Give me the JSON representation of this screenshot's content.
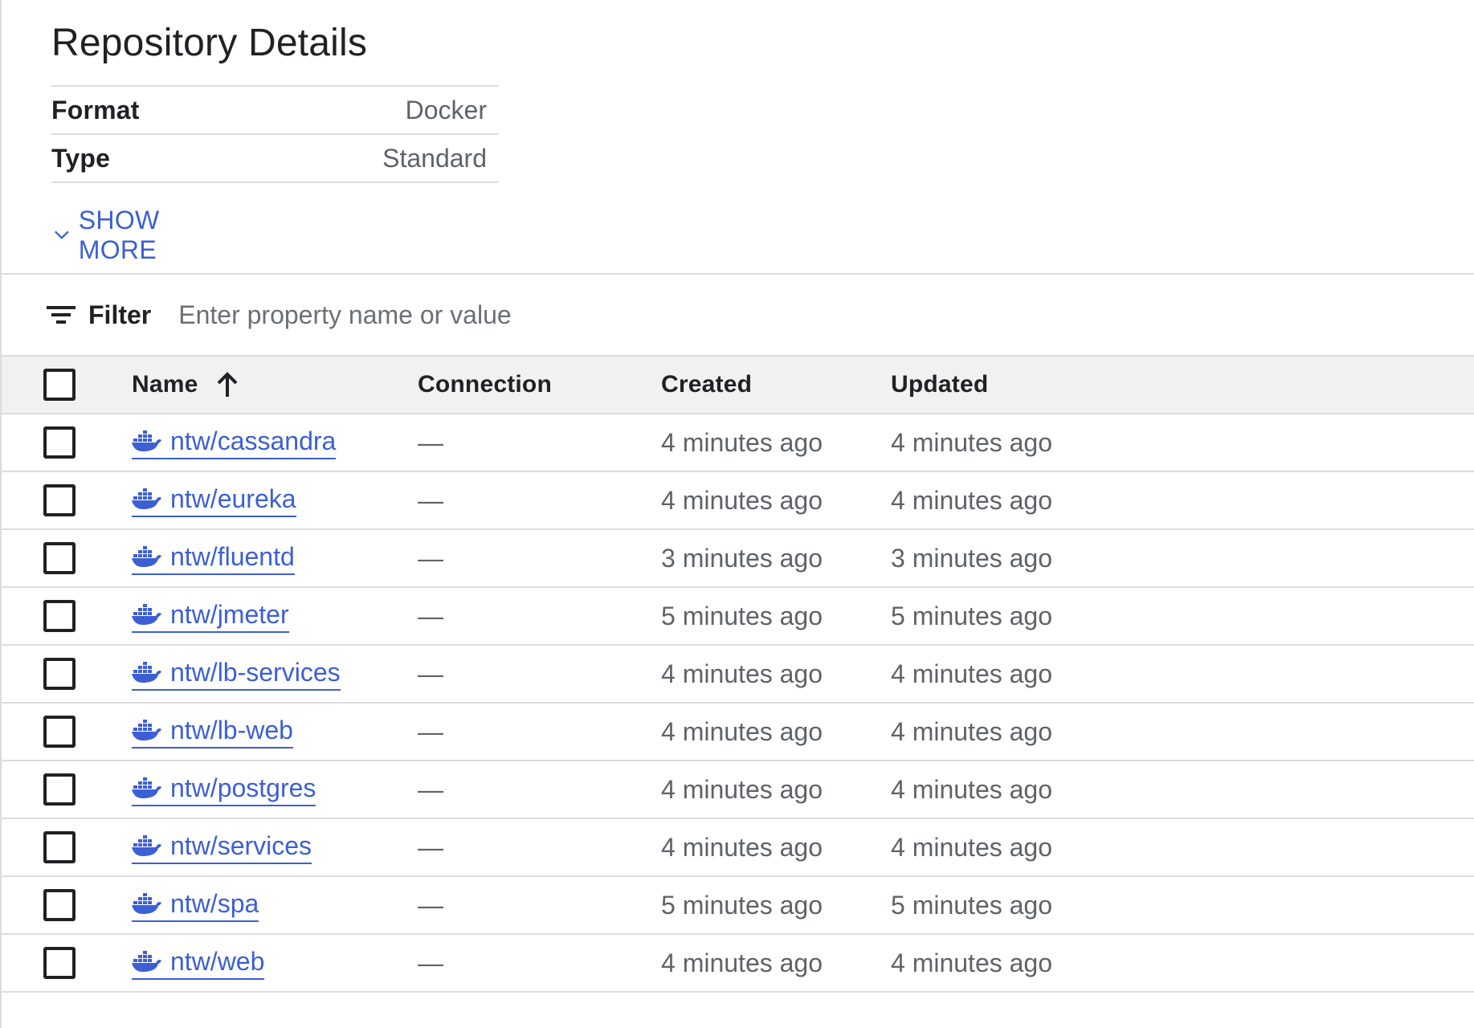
{
  "details": {
    "title": "Repository Details",
    "properties": [
      {
        "key": "Format",
        "value": "Docker"
      },
      {
        "key": "Type",
        "value": "Standard"
      }
    ],
    "show_more_label": "SHOW MORE"
  },
  "filter": {
    "label": "Filter",
    "placeholder": "Enter property name or value"
  },
  "table": {
    "columns": {
      "name": "Name",
      "connection": "Connection",
      "created": "Created",
      "updated": "Updated"
    },
    "sort": "name-ascending",
    "rows": [
      {
        "name": "ntw/cassandra",
        "connection": "—",
        "created": "4 minutes ago",
        "updated": "4 minutes ago"
      },
      {
        "name": "ntw/eureka",
        "connection": "—",
        "created": "4 minutes ago",
        "updated": "4 minutes ago"
      },
      {
        "name": "ntw/fluentd",
        "connection": "—",
        "created": "3 minutes ago",
        "updated": "3 minutes ago"
      },
      {
        "name": "ntw/jmeter",
        "connection": "—",
        "created": "5 minutes ago",
        "updated": "5 minutes ago"
      },
      {
        "name": "ntw/lb-services",
        "connection": "—",
        "created": "4 minutes ago",
        "updated": "4 minutes ago"
      },
      {
        "name": "ntw/lb-web",
        "connection": "—",
        "created": "4 minutes ago",
        "updated": "4 minutes ago"
      },
      {
        "name": "ntw/postgres",
        "connection": "—",
        "created": "4 minutes ago",
        "updated": "4 minutes ago"
      },
      {
        "name": "ntw/services",
        "connection": "—",
        "created": "4 minutes ago",
        "updated": "4 minutes ago"
      },
      {
        "name": "ntw/spa",
        "connection": "—",
        "created": "5 minutes ago",
        "updated": "5 minutes ago"
      },
      {
        "name": "ntw/web",
        "connection": "—",
        "created": "4 minutes ago",
        "updated": "4 minutes ago"
      }
    ]
  },
  "icons": {
    "row_icon": "docker-icon",
    "filter_icon": "filter-list-icon",
    "sort_icon": "arrow-up-icon",
    "show_more_icon": "chevron-down-icon"
  },
  "colors": {
    "link": "#3c5fd4",
    "header_bg": "#f1f1f1",
    "divider": "#dadce0"
  }
}
